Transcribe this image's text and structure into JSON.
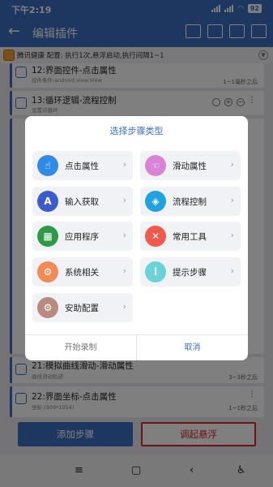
{
  "status_bar": {
    "time": "下午2:19",
    "battery": "92"
  },
  "app_bar": {
    "title": "编辑插件"
  },
  "info_bar": {
    "text": "腾讯健康  配置: 执行1次,悬浮启动,执行间隔1~1"
  },
  "steps": [
    {
      "title": "12:界面控件-点击属性",
      "subtitle": "控件条件:android.view.View",
      "delay": "1~1毫秒之后"
    },
    {
      "title": "13:循环逻辑-流程控制",
      "subtitle": "设置点循环",
      "delay": ""
    },
    {
      "title": "21:模拟曲线滑动-滑动属性",
      "subtitle": "曲线滑动轨迹",
      "delay": "3~3秒之后"
    },
    {
      "title": "22:界面坐标-点击属性",
      "subtitle": "坐标:(909*1054)",
      "delay": "1~1秒之后"
    }
  ],
  "bottom": {
    "add_label": "添加步骤",
    "float_label": "调起悬浮"
  },
  "dialog": {
    "title": "选择步骤类型",
    "options": [
      {
        "label": "点击属性",
        "icon": "hand-pointer-icon",
        "color": "#2f8be6",
        "glyph": "☝"
      },
      {
        "label": "滑动属性",
        "icon": "swipe-hand-icon",
        "color": "#d983d6",
        "glyph": "☜"
      },
      {
        "label": "输入获取",
        "icon": "letter-a-icon",
        "color": "#3b5ccc",
        "glyph": "A"
      },
      {
        "label": "流程控制",
        "icon": "cube-icon",
        "color": "#1ea2e0",
        "glyph": "◈"
      },
      {
        "label": "应用程序",
        "icon": "apps-grid-icon",
        "color": "#2e9a48",
        "glyph": "▦"
      },
      {
        "label": "常用工具",
        "icon": "tools-icon",
        "color": "#ef5a4a",
        "glyph": "✕"
      },
      {
        "label": "系统相关",
        "icon": "gear-icon",
        "color": "#f28a55",
        "glyph": "⚙"
      },
      {
        "label": "提示步骤",
        "icon": "info-icon",
        "color": "#6ad3d8",
        "glyph": "i"
      },
      {
        "label": "安助配置",
        "icon": "settings-icon",
        "color": "#b88a80",
        "glyph": "⚙"
      }
    ],
    "left_button": "开始录制",
    "right_button": "取消"
  }
}
